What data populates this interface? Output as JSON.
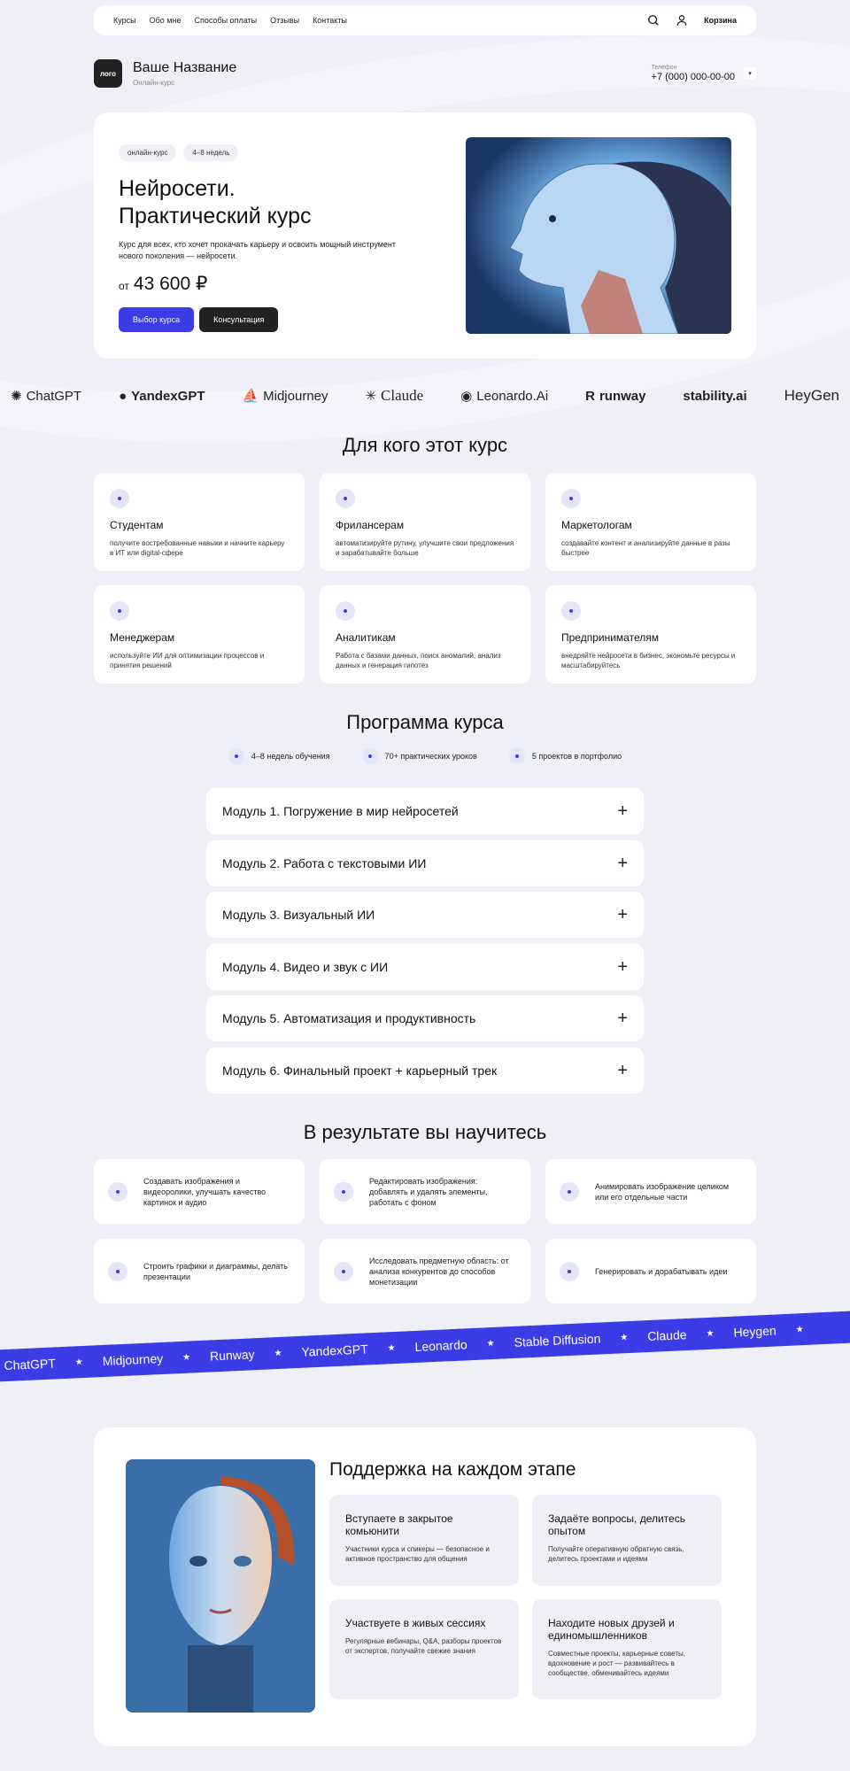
{
  "nav": {
    "links": [
      "Курсы",
      "Обо мне",
      "Способы оплаты",
      "Отзывы",
      "Контакты"
    ],
    "cart_label": "Корзина"
  },
  "brand": {
    "logo_text": "лого",
    "name": "Ваше Название",
    "subtitle": "Онлайн-курс",
    "phone_label": "Телефон",
    "phone": "+7 (000) 000-00-00"
  },
  "hero": {
    "tags": [
      "онлайн-курс",
      "4–8 недель"
    ],
    "title_line1": "Нейросети.",
    "title_line2": "Практический курс",
    "description": "Курс для всех, кто хочет прокачать карьеру и освоить мощный инструмент нового поколения — нейросети.",
    "price_prefix": "от",
    "price": "43 600 ₽",
    "btn_primary": "Выбор курса",
    "btn_secondary": "Консультация"
  },
  "ai_logos": [
    "ChatGPT",
    "YandexGPT",
    "Midjourney",
    "Claude",
    "Leonardo.Ai",
    "runway",
    "stability.ai",
    "HeyGen"
  ],
  "audience": {
    "title": "Для кого этот курс",
    "items": [
      {
        "title": "Студентам",
        "desc": "получите востребованные навыки и начните карьеру в ИТ или digital-сфере"
      },
      {
        "title": "Фрилансерам",
        "desc": "автоматизируйте рутину, улучшите свои предложения и зарабатывайте больше"
      },
      {
        "title": "Маркетологам",
        "desc": "создавайте контент и анализируйте данные в разы быстрее"
      },
      {
        "title": "Менеджерам",
        "desc": "используйте ИИ для оптимизации процессов и принятия решений"
      },
      {
        "title": "Аналитикам",
        "desc": "Работа с базами данных, поиск аномалий, анализ данных и генерация гипотез"
      },
      {
        "title": "Предпринимателям",
        "desc": "внедряйте нейросети в бизнес, экономьте ресурсы и масштабируйтесь"
      }
    ]
  },
  "program": {
    "title": "Программа курса",
    "stats": [
      "4–8 недель обучения",
      "70+ практических уроков",
      "5 проектов в портфолио"
    ],
    "modules": [
      "Модуль 1. Погружение в мир нейросетей",
      "Модуль 2. Работа с текстовыми ИИ",
      "Модуль 3. Визуальный ИИ",
      "Модуль 4. Видео и звук с ИИ",
      "Модуль 5. Автоматизация и продуктивность",
      "Модуль 6. Финальный проект + карьерный трек"
    ]
  },
  "results": {
    "title": "В результате вы научитесь",
    "items": [
      "Создавать изображения и видеоролики, улучшать качество картинок и аудио",
      "Редактировать изображения: добавлять и удалять элементы, работать с фоном",
      "Анимировать изображение целиком или его отдельные части",
      "Строить графики и диаграммы, делать презентации",
      "Исследовать предметную область: от анализа конкурентов до способов монетизации",
      "Генерировать и дорабатывать идеи"
    ]
  },
  "ribbon": [
    "ChatGPT",
    "Midjourney",
    "Runway",
    "YandexGPT",
    "Leonardo",
    "Stable Diffusion",
    "Claude",
    "Heygen"
  ],
  "support": {
    "title": "Поддержка на каждом этапе",
    "cards": [
      {
        "title": "Вступаете в закрытое комьюнити",
        "desc": "Участники курса и спикеры — безопасное и активное пространство для общения"
      },
      {
        "title": "Задаёте вопросы, делитесь опытом",
        "desc": "Получайте оперативную обратную связь, делитесь проектами и идеями"
      },
      {
        "title": "Участвуете в живых сессиях",
        "desc": "Регулярные вебинары, Q&A, разборы проектов от экспертов, получайте свежие знания"
      },
      {
        "title": "Находите новых друзей и единомышленников",
        "desc": "Совместные проекты, карьерные советы, вдохновение и рост — развивайтесь в сообществе, обменивайтесь идеями"
      }
    ]
  },
  "colors": {
    "accent": "#3c3ce6",
    "bg": "#eef0f6",
    "dark": "#222222"
  }
}
